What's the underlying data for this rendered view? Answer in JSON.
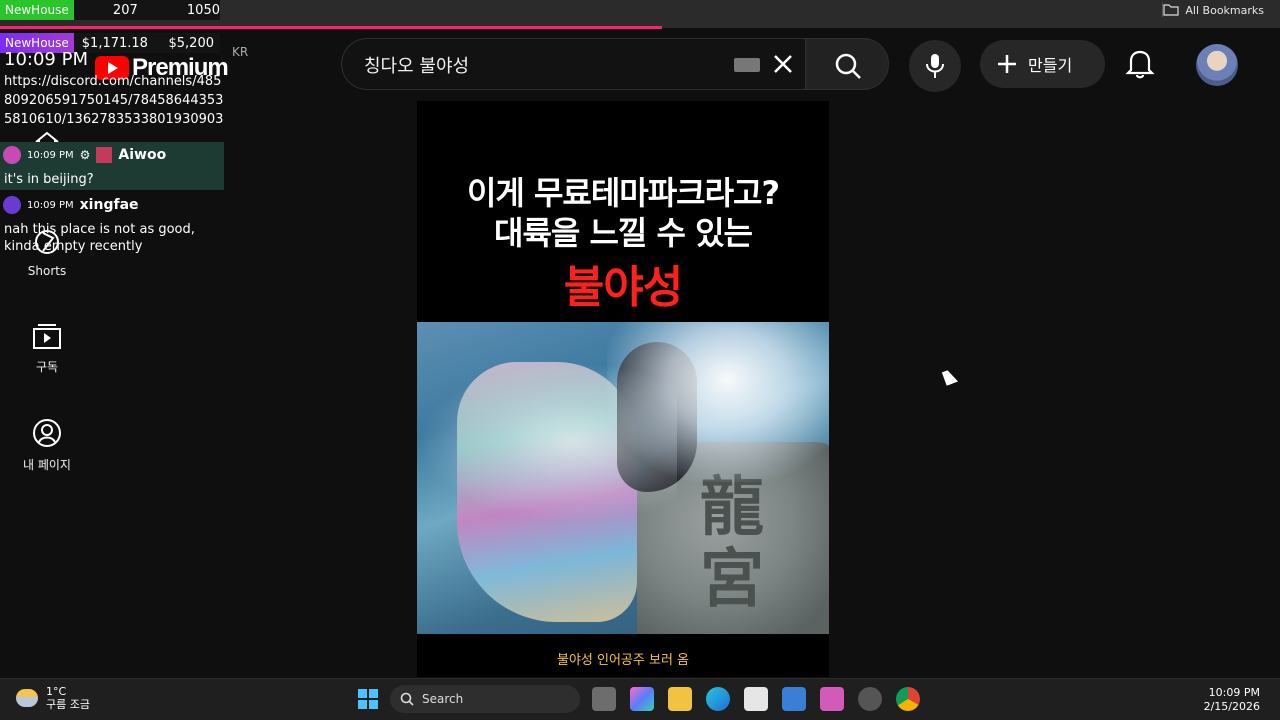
{
  "ticker": {
    "tag": "NewHouse",
    "n1": "207",
    "n2": "1050"
  },
  "overlay": {
    "tag": "NewHouse",
    "money1": "$1,171.18",
    "money2": "$5,200"
  },
  "stream_time": "10:09 PM",
  "youtube": {
    "word": "Premium",
    "region": "KR"
  },
  "discord_url": "https://discord.com/channels/485809206591750145/784586443535810610/1362783533801930903",
  "chat": [
    {
      "time": "10:09 PM",
      "name": "Aiwoo",
      "msg": "it's in beijing?"
    },
    {
      "time": "10:09 PM",
      "name": "xingfae",
      "msg": "nah this place is not as good, kinda empty recently"
    }
  ],
  "bookmarks_label": "All Bookmarks",
  "sidebar": [
    {
      "label": "Shorts",
      "icon": "shorts-icon"
    },
    {
      "label": "구독",
      "icon": "subscriptions-icon"
    },
    {
      "label": "내 페이지",
      "icon": "profile-icon"
    }
  ],
  "search": {
    "value": "칭다오 불야성"
  },
  "create_label": "만들기",
  "video": {
    "headline_line1": "이게 무료테마파크라고?",
    "headline_line2": "대륙을 느낄 수 있는",
    "headline_red": "불야성",
    "pillar_text": "龍宮",
    "subtitle": "불야성 인어공주 보러 옴"
  },
  "taskbar": {
    "temp": "1°C",
    "weather": "구름 조금",
    "search": "Search",
    "time": "10:09 PM",
    "date": "2/15/2026"
  },
  "colors": {
    "progress": "#ff1f6b",
    "red_title": "#ff2020",
    "subtitle": "#f4c542"
  }
}
